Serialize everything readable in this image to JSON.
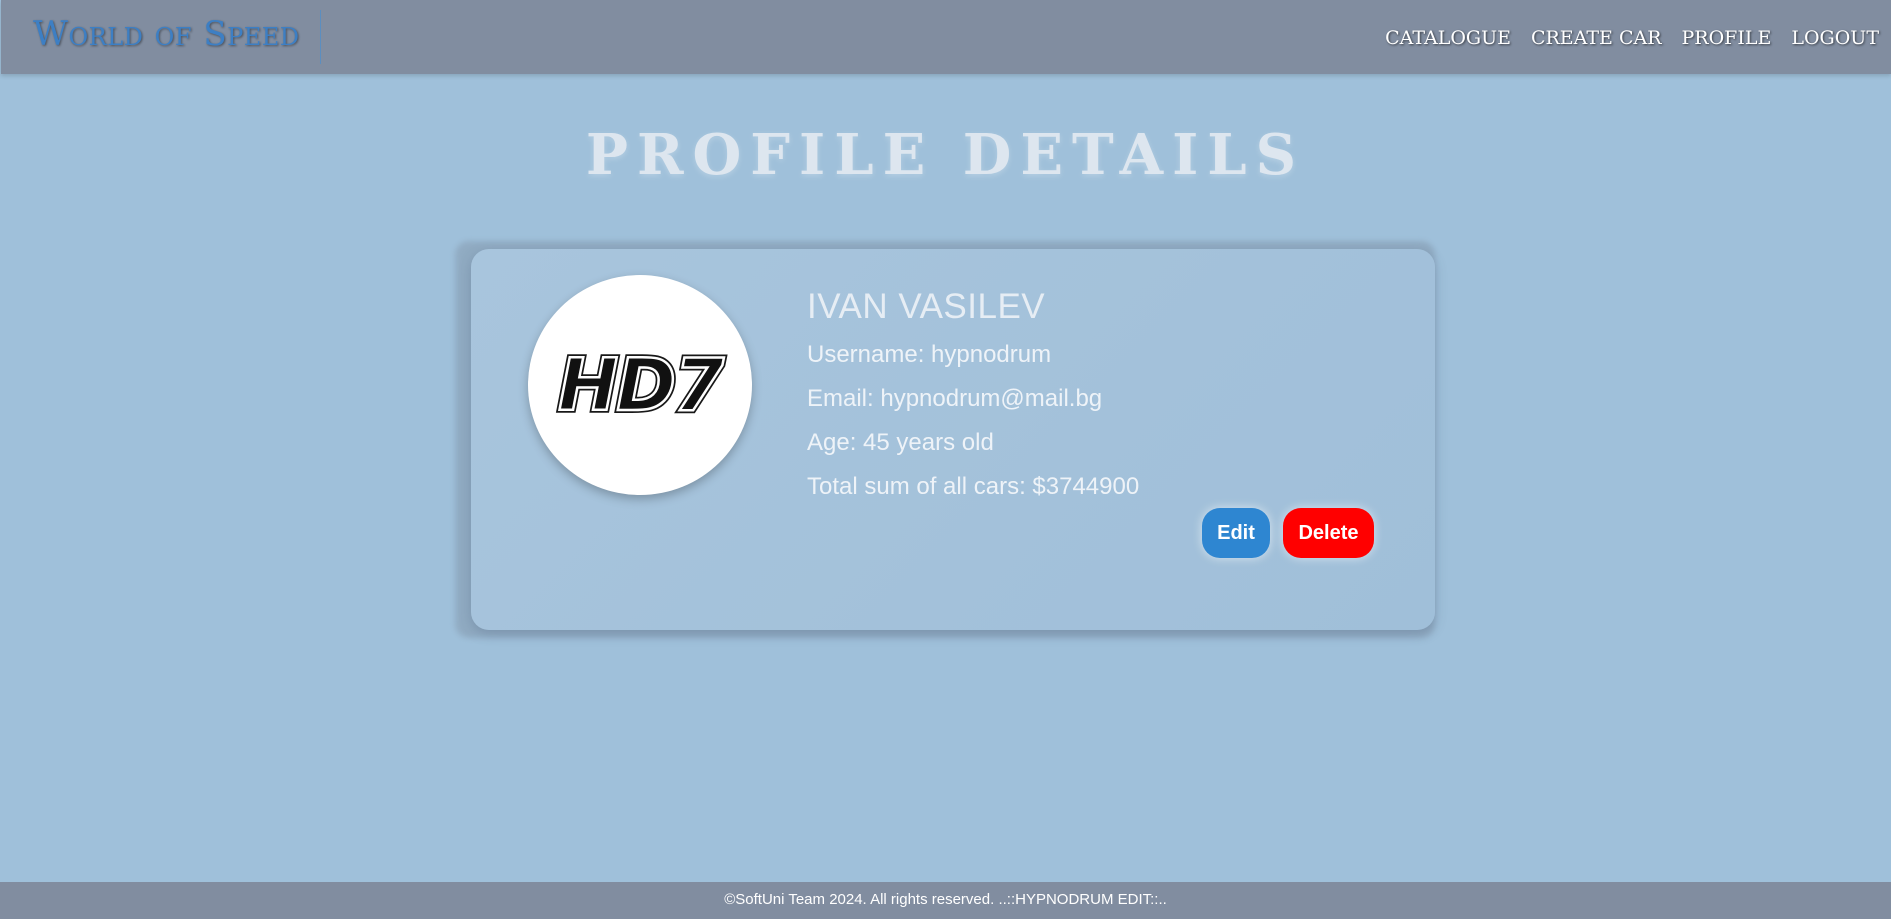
{
  "header": {
    "brand": "World of Speed",
    "nav": [
      {
        "label": "CATALOGUE"
      },
      {
        "label": "CREATE CAR"
      },
      {
        "label": "PROFILE"
      },
      {
        "label": "LOGOUT"
      }
    ]
  },
  "main": {
    "title": "PROFILE DETAILS",
    "profile": {
      "avatar_icon": "hd7-logo-icon",
      "avatar_text": "HD7",
      "name": "IVAN VASILEV",
      "username_line": "Username: hypnodrum",
      "email_line": "Email: hypnodrum@mail.bg",
      "age_line": "Age: 45 years old",
      "total_line": "Total sum of all cars: $3744900"
    },
    "actions": {
      "edit_label": "Edit",
      "delete_label": "Delete"
    }
  },
  "footer": {
    "text": "©SoftUni Team 2024. All rights reserved. ..::HYPNODRUM EDIT::.."
  },
  "colors": {
    "background": "#9fc0da",
    "header": "#818da0",
    "brand": "#3d7fc4",
    "edit_button": "#2e86d1",
    "delete_button": "#ff0000"
  }
}
